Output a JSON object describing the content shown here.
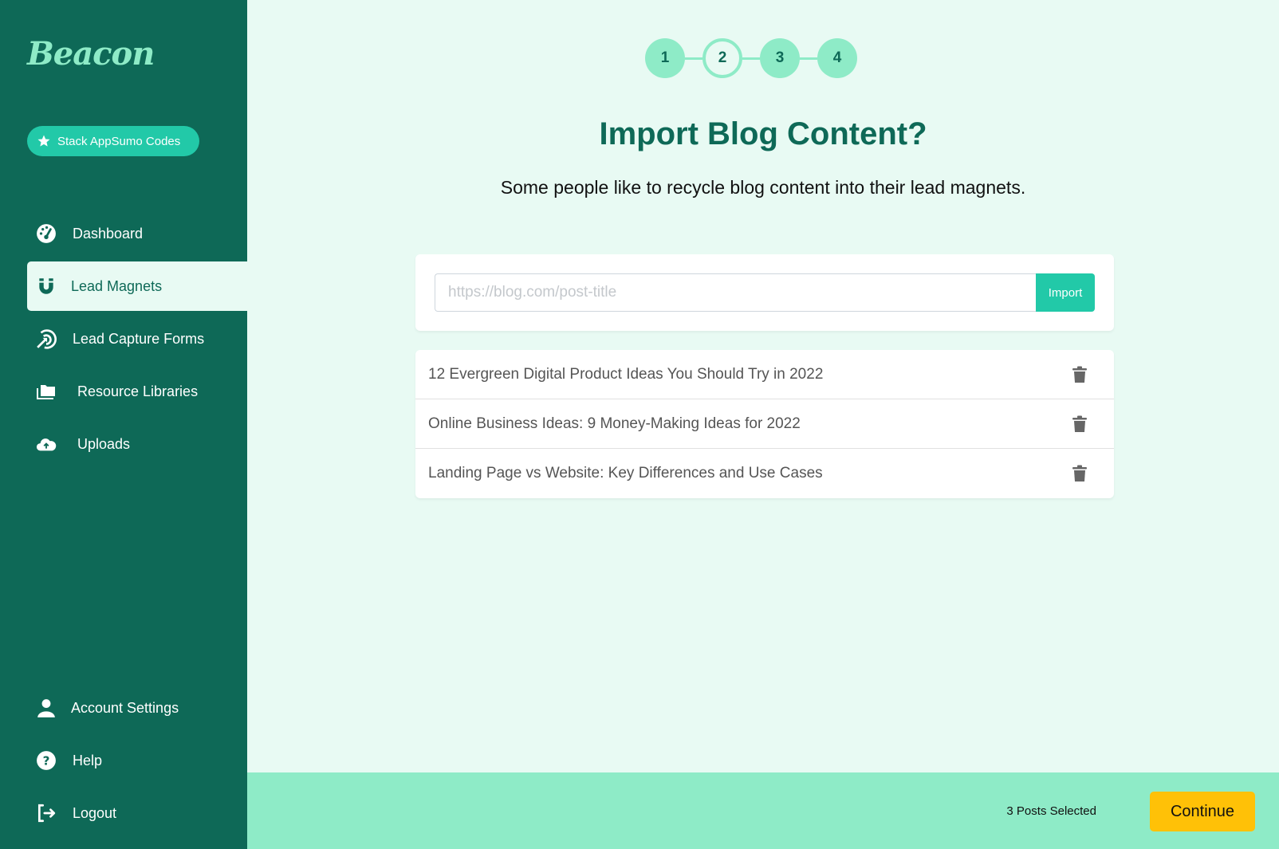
{
  "sidebar": {
    "logo": "Beacon",
    "appsumo_button": "Stack AppSumo Codes",
    "nav_items": [
      {
        "label": "Dashboard",
        "icon": "dashboard-gauge-icon"
      },
      {
        "label": "Lead Magnets",
        "icon": "magnet-icon",
        "active": true
      },
      {
        "label": "Lead Capture Forms",
        "icon": "target-arrow-icon"
      },
      {
        "label": "Resource Libraries",
        "icon": "folder-icon"
      },
      {
        "label": "Uploads",
        "icon": "cloud-upload-icon"
      }
    ],
    "bottom_items": [
      {
        "label": "Account Settings",
        "icon": "user-icon"
      },
      {
        "label": "Help",
        "icon": "help-icon"
      },
      {
        "label": "Logout",
        "icon": "logout-icon"
      }
    ]
  },
  "stepper": {
    "steps": [
      "1",
      "2",
      "3",
      "4"
    ],
    "current_step": 2
  },
  "main": {
    "title": "Import Blog Content?",
    "subtitle": "Some people like to recycle blog content into their lead magnets.",
    "url_input": {
      "placeholder": "https://blog.com/post-title",
      "value": ""
    },
    "import_button": "Import",
    "posts": [
      {
        "title": "12 Evergreen Digital Product Ideas You Should Try in 2022"
      },
      {
        "title": "Online Business Ideas: 9 Money-Making Ideas for 2022"
      },
      {
        "title": "Landing Page vs Website: Key Differences and Use Cases"
      }
    ]
  },
  "footer": {
    "selected_count": "3 Posts Selected",
    "continue_button": "Continue"
  },
  "colors": {
    "sidebar_bg": "#0e6957",
    "accent": "#22c9a8",
    "light_mint": "#8eebc7",
    "page_bg": "#e8faf3",
    "cta": "#ffc107"
  }
}
